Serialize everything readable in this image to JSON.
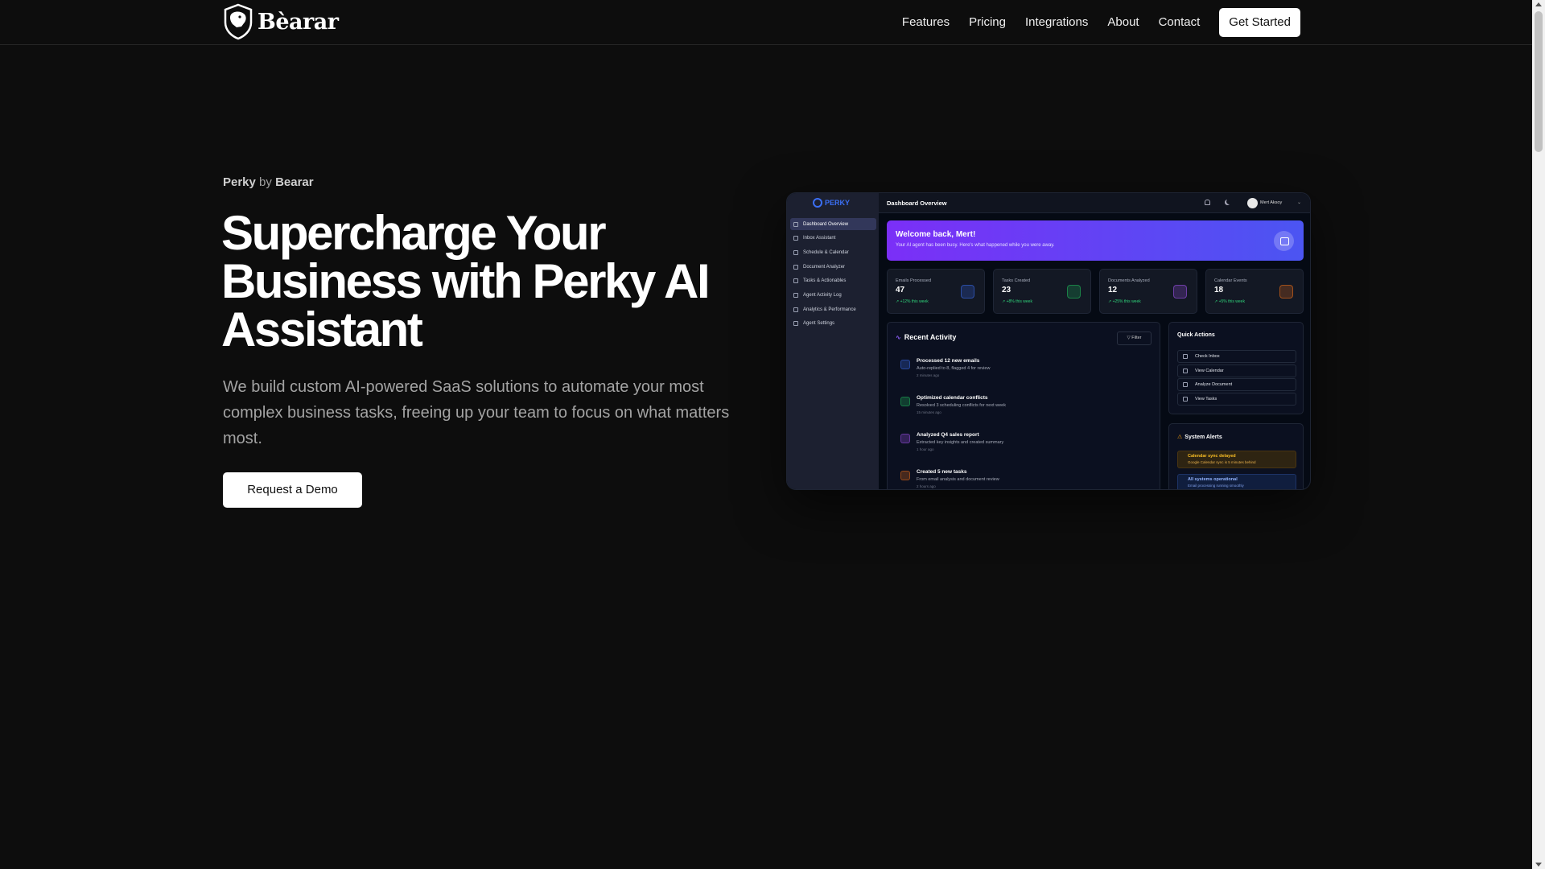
{
  "brand": {
    "name": "Bèarar"
  },
  "nav": {
    "links": [
      "Features",
      "Pricing",
      "Integrations",
      "About",
      "Contact"
    ],
    "cta": "Get Started"
  },
  "hero": {
    "eyebrow_product": "Perky",
    "eyebrow_by": "by",
    "eyebrow_company": "Bearar",
    "headline": "Supercharge Your Business with Perky AI Assistant",
    "subhead": "We build custom AI-powered SaaS solutions to automate your most complex business tasks, freeing up your team to focus on what matters most.",
    "cta": "Request a Demo"
  },
  "dashboard": {
    "logo": "PERKY",
    "title": "Dashboard Overview",
    "user": "Mert Aksoy",
    "sidebar": [
      "Dashboard Overview",
      "Inbox Assistant",
      "Schedule & Calendar",
      "Document Analyzer",
      "Tasks & Actionables",
      "Agent Activity Log",
      "Analytics & Performance",
      "Agent Settings"
    ],
    "welcome": {
      "title": "Welcome back, Mert!",
      "subtitle": "Your AI agent has been busy. Here's what happened while you were away."
    },
    "stats": [
      {
        "label": "Emails Processed",
        "value": "47",
        "change": "↗ +12% this week",
        "color": "#3b6ff5"
      },
      {
        "label": "Tasks Created",
        "value": "23",
        "change": "↗ +8% this week",
        "color": "#22c55e"
      },
      {
        "label": "Documents Analyzed",
        "value": "12",
        "change": "↗ +25% this week",
        "color": "#a855f7"
      },
      {
        "label": "Calendar Events",
        "value": "18",
        "change": "↗ +5% this week",
        "color": "#f97316"
      }
    ],
    "activity": {
      "title": "Recent Activity",
      "filter": "Filter",
      "items": [
        {
          "title": "Processed 12 new emails",
          "desc": "Auto-replied to 8, flagged 4 for review",
          "time": "2 minutes ago",
          "color": "#3b6ff5"
        },
        {
          "title": "Optimized calendar conflicts",
          "desc": "Resolved 3 scheduling conflicts for next week",
          "time": "15 minutes ago",
          "color": "#22c55e"
        },
        {
          "title": "Analyzed Q4 sales report",
          "desc": "Extracted key insights and created summary",
          "time": "1 hour ago",
          "color": "#a855f7"
        },
        {
          "title": "Created 5 new tasks",
          "desc": "From email analysis and document review",
          "time": "2 hours ago",
          "color": "#f97316"
        }
      ]
    },
    "quick_actions": {
      "title": "Quick Actions",
      "items": [
        "Check Inbox",
        "View Calendar",
        "Analyze Document",
        "View Tasks"
      ]
    },
    "alerts": {
      "title": "System Alerts",
      "warning_title": "Calendar sync delayed",
      "warning_desc": "Google Calendar sync is 5 minutes behind",
      "info_title": "All systems operational",
      "info_desc": "Email processing running smoothly"
    }
  }
}
